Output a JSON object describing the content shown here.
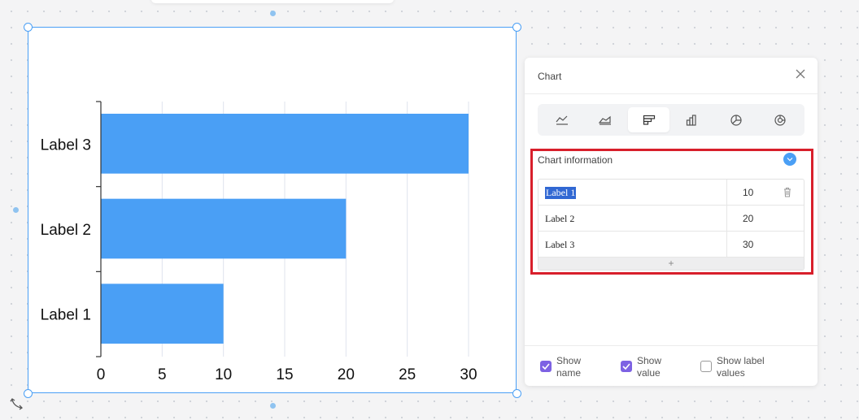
{
  "chart_data": {
    "type": "bar",
    "orientation": "horizontal",
    "categories": [
      "Label 3",
      "Label 2",
      "Label 1"
    ],
    "values": [
      30,
      20,
      10
    ],
    "xlim": [
      0,
      30
    ],
    "xticks": [
      "0",
      "5",
      "10",
      "15",
      "20",
      "25",
      "30"
    ],
    "grid": true,
    "color": "#4a9ff5"
  },
  "panel": {
    "title": "Chart",
    "chart_types": [
      "line-chart-icon",
      "area-chart-icon",
      "horizontal-bar-chart-icon",
      "vertical-bar-chart-icon",
      "pie-chart-icon",
      "donut-chart-icon"
    ],
    "active_type": "horizontal-bar-chart-icon",
    "section_label": "Chart information",
    "rows": [
      {
        "name": "Label 1",
        "value": "10"
      },
      {
        "name": "Label 2",
        "value": "20"
      },
      {
        "name": "Label 3",
        "value": "30"
      }
    ],
    "add_row_label": "+",
    "options": {
      "show_name": "Show name",
      "show_value": "Show value",
      "show_label_values": "Show label values"
    }
  },
  "colors": {
    "accent": "#4a9ff5",
    "checkbox": "#7d62e3",
    "highlight": "#d81f2b"
  }
}
